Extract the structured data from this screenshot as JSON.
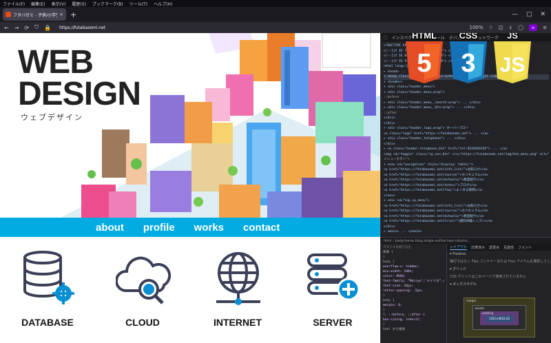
{
  "menubar": {
    "items": [
      "ファイル(F)",
      "編集(E)",
      "表示(V)",
      "履歴(S)",
      "ブックマーク(B)",
      "ツール(T)",
      "ヘルプ(H)"
    ]
  },
  "tab": {
    "title": "フタバゼミ - 子供/小学生・中学生",
    "close": "×",
    "new": "+"
  },
  "navbar": {
    "back": "←",
    "forward": "→",
    "reload": "⟳",
    "url": "https://futabazemi.net",
    "zoom": "100%"
  },
  "hero": {
    "title_line1": "WEB",
    "title_line2": "DESIGN",
    "subtitle": "ウェブデザイン"
  },
  "sitenav": {
    "items": [
      "about",
      "profile",
      "works",
      "contact"
    ]
  },
  "cards": [
    {
      "label": "DATABASE"
    },
    {
      "label": "CLOUD"
    },
    {
      "label": "INTERNET"
    },
    {
      "label": "SERVER"
    }
  ],
  "badges": {
    "html": "HTML",
    "css": "CSS",
    "js": "JS",
    "html_num": "5",
    "css_num": "3",
    "js_mark": "JS"
  },
  "devtools": {
    "tabs": [
      "インスペクター",
      "コンソール",
      "デバッガー",
      "ネットワーク"
    ],
    "code_lines": [
      "<!DOCTYPE html>",
      "<!--[if IE 7]> <html class=\"ie7\"> <![endif]-->",
      "<!--[if IE 8]> <html class=\"ie8\"> <![endif]-->",
      "<!--[if IE 9]> <html class=\"ie9\"> <![endif]-->",
      "<html lang=\"ja\" ...>",
      "▸ <head> ... </head>",
      "▾ <body class=\"home blog single-author two-column right-sidebar\">",
      "  ▾ <header>",
      "    ▾ <div class=\"header_menu\">",
      "      ▾ <div class=\"header_menu_wrap\">",
      "          ::before",
      "        ▸ <div class=\"header_menu__search-wrap\"> ... </div>",
      "        ▸ <div class=\"header_menu__btn-wrap\"> ... </div>",
      "          ::after",
      "        </div>",
      "      </div>",
      "    ▾ <div class=\"header_logo_wrap\"> オーバーフロー",
      "        <a class=\"logo\" href=\"https://futabazemi.net\"> ... </a>",
      "      ▸ <div class=\"header_telephone\"> ... </div>",
      "      </div>",
      "    ▸ <a class=\"header_telephone_btn\" href=\"tel:0120456265\"> ... </a>",
      "      <img id=\"toggle\" class=\"sp_nav_btn\" src=\"https://futabazemi.net/img/btn_menu.png\" alt=\"",
      "      メニューボタン\">",
      "  ▾ <nav id=\"navigation\" style=\"display: table;\">",
      "      <a href=\"https://futabazemi.net/info_list/\">お知らせ</a>",
      "      <a href=\"https://futabazemi.net/course/\">カリキュラム</a>",
      "      <a href=\"https://futabazemi.net/mchaela/\">教室紹介</a>",
      "      <a href=\"https://futabazemi.net/notes/\">ブログ</a>",
      "      <a href=\"https://futabazemi.net/faq/\">よくある質問</a>",
      "    </nav>",
      "  ▾ <div id=\"top_sp_menu\">",
      "      <a href=\"https://futabazemi.net/info_list/\">お知らせ</a>",
      "      <a href=\"https://futabazemi.net/course/\">カリキュラム</a>",
      "      <a href=\"https://futabazemi.net/mchaela/\">教室紹介</a>",
      "      <a href=\"https://futabazemi.net/trial/\">無料体験レッスン</a>",
      "    </div>",
      "  ▸ <main> ... </main>"
    ],
    "breadcrumb": "html › body.home.blog.single-author.two-column...",
    "rules_filter": "スタイルを絞り込む",
    "rules_lines": [
      "要素 {",
      "}",
      "body {",
      "  overflow-x: hidden;",
      "  min-width: 100%;",
      "  color: #666;",
      "  font-family: \"Meiryo\",\"メイリオ\",sans-serif;",
      "  font-size: 16px;",
      "  letter-spacing: .5px;",
      "}",
      "body {",
      "  margin: 0;",
      "}",
      "*, ::before, ::after {",
      "  box-sizing: inherit;",
      "}",
      "html から継承"
    ],
    "layout_tabs": [
      "レイアウト",
      "計算済み",
      "変更点",
      "互換性",
      "フォント"
    ],
    "layout_rows": [
      "▾ Flexbox",
      "横行ではなく Flex コンテナーまたは Flex アイテムを選択してください",
      "▾ グリッド",
      "CSS グリッドはこのページで使用されていません",
      "▾ ボックスモデル"
    ],
    "boxmodel": {
      "margin": "margin",
      "border": "border",
      "padding": "padding",
      "content": "1321×4022.42",
      "zero": "0"
    }
  }
}
